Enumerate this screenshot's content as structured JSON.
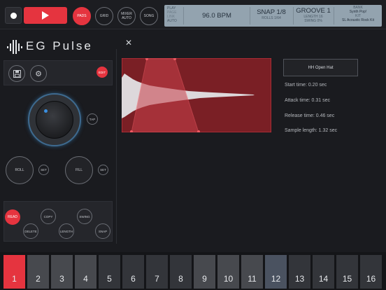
{
  "transport": {
    "pads_label": "PADS",
    "grid_label": "GRID",
    "mixer_label_1": "MIXER",
    "mixer_label_2": "AUTO",
    "song_label": "SONG"
  },
  "lcd": {
    "mode_1": "PLAY",
    "mode_2": "PAGE",
    "mode_3": "LINK",
    "mode_4": "AUTO",
    "bpm": "96.0 BPM",
    "snap": "SNAP 1/8",
    "rolls": "ROLLS 1/64",
    "groove": "GROOVE 1",
    "length": "LENGTH 16",
    "swing": "SWING 0%",
    "bank_label": "BANK",
    "bank": "Synth Pop!",
    "kit_label": "KIT",
    "kit": "SL Acoustic Rock Kit"
  },
  "logo": {
    "text": "EG Pulse"
  },
  "left": {
    "edit_label": "EDIT",
    "tap_label": "TAP",
    "roll_label": "ROLL",
    "roll_set_label": "SET",
    "fill_label": "FILL",
    "fill_set_label": "SET",
    "read_label": "READ",
    "copy_label": "COPY",
    "swing_label": "SWING",
    "delete_label": "DELETE",
    "length_label": "LENGTH",
    "snap_label": "SNAP"
  },
  "sample": {
    "name": "HH Open Hat",
    "start": "Start time: 0.20 sec",
    "attack": "Attack time: 0.31 sec",
    "release": "Release time: 0.46 sec",
    "length": "Sample length: 1.32 sec"
  },
  "pads": [
    "1",
    "2",
    "3",
    "4",
    "5",
    "6",
    "7",
    "8",
    "9",
    "10",
    "11",
    "12",
    "13",
    "14",
    "15",
    "16"
  ],
  "colors": {
    "accent": "#e5343f",
    "lcd": "#93a3af",
    "knob_ring": "#3e6a8f"
  }
}
